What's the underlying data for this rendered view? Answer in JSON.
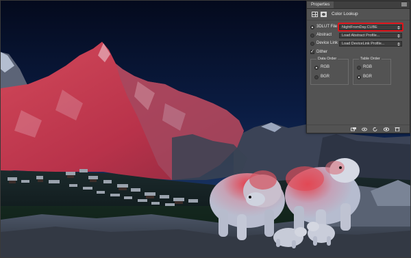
{
  "panel": {
    "tab_label": "Properties",
    "title": "Color Lookup",
    "header_icons": [
      "adjustment-grid-icon",
      "mask-icon"
    ],
    "options": [
      {
        "label": "3DLUT File",
        "value": "NightFromDay.CUBE",
        "selected": true
      },
      {
        "label": "Abstract",
        "value": "Load Abstract Profile...",
        "selected": false
      },
      {
        "label": "Device Link",
        "value": "Load DeviceLink Profile...",
        "selected": false
      }
    ],
    "dither": {
      "label": "Dither",
      "checked": true
    },
    "data_order": {
      "title": "Data Order",
      "options": [
        "RGB",
        "BGR"
      ],
      "selected": "RGB"
    },
    "table_order": {
      "title": "Table Order",
      "options": [
        "RGB",
        "BGR"
      ],
      "selected": "BGR"
    },
    "bottom_icons": [
      "clip-to-layer-icon",
      "view-previous-icon",
      "reset-icon",
      "visibility-icon",
      "delete-icon"
    ]
  },
  "colors": {
    "panel_bg": "#535353",
    "highlight": "#e0141b",
    "sky_top": "#06102a",
    "sky_bottom": "#1d3a6e",
    "red_tint": "#e23a4a"
  }
}
